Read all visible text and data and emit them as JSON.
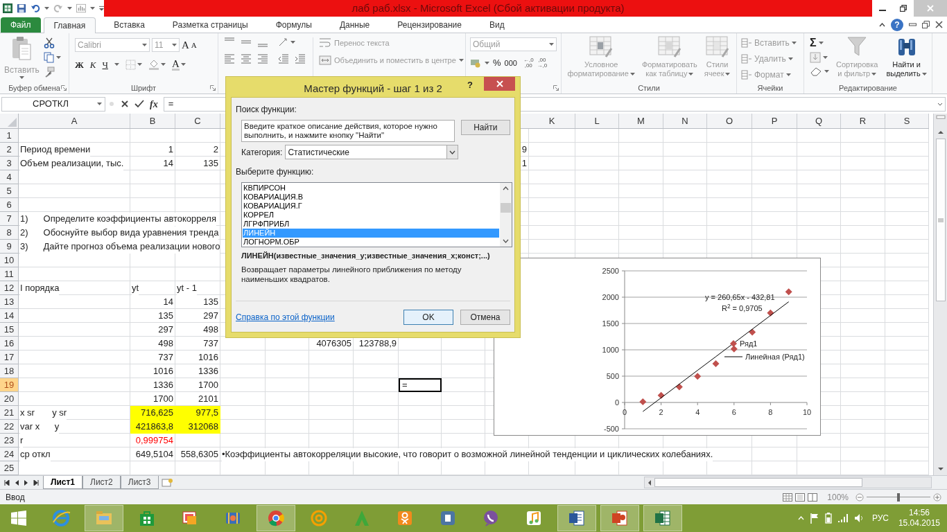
{
  "window": {
    "title": "лаб  раб.xlsx  -  Microsoft Excel (Сбой активации продукта)"
  },
  "ribbon_tabs": [
    {
      "label": "Файл",
      "kind": "file",
      "selected": false
    },
    {
      "label": "Главная",
      "kind": "tab",
      "selected": true
    },
    {
      "label": "Вставка",
      "kind": "tab",
      "selected": false
    },
    {
      "label": "Разметка страницы",
      "kind": "tab",
      "selected": false
    },
    {
      "label": "Формулы",
      "kind": "tab",
      "selected": false
    },
    {
      "label": "Данные",
      "kind": "tab",
      "selected": false
    },
    {
      "label": "Рецензирование",
      "kind": "tab",
      "selected": false
    },
    {
      "label": "Вид",
      "kind": "tab",
      "selected": false
    }
  ],
  "help_button": "?",
  "ribbon": {
    "clipboard": {
      "group": "Буфер обмена",
      "paste": {
        "label": "Вставить",
        "disabled": true
      }
    },
    "font": {
      "group": "Шрифт",
      "name": {
        "label": "Calibri",
        "disabled": true
      },
      "size": {
        "label": "11",
        "disabled": true
      },
      "grow": {
        "label": "A",
        "disabled": false
      },
      "shrink": {
        "label": "A",
        "disabled": false
      },
      "bold": {
        "label": "Ж",
        "disabled": false
      },
      "italic": {
        "label": "К",
        "disabled": false
      },
      "underline": {
        "label": "Ч",
        "disabled": false
      },
      "color": {
        "label": "A",
        "disabled": false
      }
    },
    "alignment": {
      "wrap": {
        "label": "Перенос текста",
        "disabled": true
      },
      "merge": {
        "label": "Объединить и поместить в центре",
        "disabled": true
      }
    },
    "number": {
      "format": {
        "label": "Общий",
        "disabled": true
      },
      "percent": {
        "label": "%",
        "disabled": false
      },
      "thousands": {
        "label": "000",
        "disabled": false
      },
      "increase_decimal": {
        "top": "←,0",
        "bottom": ",00"
      },
      "decrease_decimal": {
        "top": ",00",
        "bottom": "→,0"
      }
    },
    "styles": {
      "group": "Стили",
      "conditional": {
        "lines": [
          "Условное",
          "форматирование"
        ],
        "disabled": true
      },
      "table": {
        "lines": [
          "Форматировать",
          "как таблицу"
        ],
        "disabled": true
      },
      "cell_styles": {
        "lines": [
          "Стили",
          "ячеек"
        ],
        "disabled": true
      }
    },
    "cells": {
      "group": "Ячейки",
      "insert": {
        "label": "Вставить",
        "disabled": true
      },
      "delete": {
        "label": "Удалить",
        "disabled": true
      },
      "format": {
        "label": "Формат",
        "disabled": true
      }
    },
    "editing": {
      "group": "Редактирование",
      "sum": {
        "label": "Σ",
        "disabled": false
      },
      "sort": {
        "lines": [
          "Сортировка",
          "и фильтр"
        ],
        "disabled": true
      },
      "find": {
        "lines": [
          "Найти и",
          "выделить"
        ],
        "disabled": false
      }
    }
  },
  "formula_bar": {
    "name_box": "СРОТКЛ",
    "function_button": "fx",
    "formula": "="
  },
  "sheet": {
    "columns": [
      {
        "label": "A",
        "selected": false
      },
      {
        "label": "B",
        "selected": false
      },
      {
        "label": "C",
        "selected": false
      },
      {
        "label": "K",
        "selected": false
      },
      {
        "label": "L",
        "selected": false
      },
      {
        "label": "M",
        "selected": false
      },
      {
        "label": "N",
        "selected": false
      },
      {
        "label": "O",
        "selected": false
      },
      {
        "label": "P",
        "selected": false
      },
      {
        "label": "Q",
        "selected": false
      },
      {
        "label": "R",
        "selected": false
      },
      {
        "label": "S",
        "selected": false
      }
    ],
    "rows": [
      {
        "label": "1",
        "selected": false
      },
      {
        "label": "2",
        "selected": false,
        "A": "Период времени",
        "B": {
          "text": "1",
          "kind": "number"
        },
        "C": {
          "text": "2",
          "kind": "number"
        },
        "J": {
          "text": "9",
          "kind": "number"
        }
      },
      {
        "label": "3",
        "selected": false,
        "A": "Объем реализации, тыс.",
        "B": {
          "text": "14",
          "kind": "number"
        },
        "C": {
          "text": "135",
          "kind": "number"
        },
        "J": {
          "text": "1",
          "kind": "number"
        }
      },
      {
        "label": "4",
        "selected": false
      },
      {
        "label": "5",
        "selected": false
      },
      {
        "label": "6",
        "selected": false
      },
      {
        "label": "7",
        "selected": false,
        "A": {
          "kind": "list",
          "marker": "1)",
          "text": "Определите коэффициенты автокорреля"
        }
      },
      {
        "label": "8",
        "selected": false,
        "A": {
          "kind": "list",
          "marker": "2)",
          "text": "Обоснуйте выбор вида уравнения тренда"
        }
      },
      {
        "label": "9",
        "selected": false,
        "A": {
          "kind": "list",
          "marker": "3)",
          "text": "Дайте прогноз объема реализации нового"
        }
      },
      {
        "label": "10",
        "selected": false
      },
      {
        "label": "11",
        "selected": false
      },
      {
        "label": "12",
        "selected": false,
        "A": "I порядка",
        "B": "yt",
        "C": "yt - 1"
      },
      {
        "label": "13",
        "selected": false,
        "B": {
          "text": "14",
          "kind": "number"
        },
        "C": {
          "text": "135",
          "kind": "number"
        }
      },
      {
        "label": "14",
        "selected": false,
        "B": {
          "text": "135",
          "kind": "number"
        },
        "C": {
          "text": "297",
          "kind": "number"
        }
      },
      {
        "label": "15",
        "selected": false,
        "B": {
          "text": "297",
          "kind": "number"
        },
        "C": {
          "text": "498",
          "kind": "number"
        }
      },
      {
        "label": "16",
        "selected": false,
        "B": {
          "text": "498",
          "kind": "number"
        },
        "C": {
          "text": "737",
          "kind": "number"
        },
        "F": {
          "text": "4076305",
          "kind": "number"
        },
        "G": {
          "text": "123788,9",
          "kind": "number"
        }
      },
      {
        "label": "17",
        "selected": false,
        "B": {
          "text": "737",
          "kind": "number"
        },
        "C": {
          "text": "1016",
          "kind": "number"
        }
      },
      {
        "label": "18",
        "selected": false,
        "B": {
          "text": "1016",
          "kind": "number"
        },
        "C": {
          "text": "1336",
          "kind": "number"
        }
      },
      {
        "label": "19",
        "selected": true,
        "B": {
          "text": "1336",
          "kind": "number"
        },
        "C": {
          "text": "1700",
          "kind": "number"
        },
        "H": {
          "text": "=",
          "kind": "text",
          "selected": true
        }
      },
      {
        "label": "20",
        "selected": false,
        "B": {
          "text": "1700",
          "kind": "number"
        },
        "C": {
          "text": "2101",
          "kind": "number"
        }
      },
      {
        "label": "21",
        "selected": false,
        "A": "x sr       y sr",
        "B": {
          "text": "716,625",
          "kind": "number",
          "highlighted": true
        },
        "C": {
          "text": "977,5",
          "kind": "number",
          "highlighted": true
        }
      },
      {
        "label": "22",
        "selected": false,
        "A": "var x      y",
        "B": {
          "text": "421863,8",
          "kind": "number",
          "highlighted": true
        },
        "C": {
          "text": "312068",
          "kind": "number",
          "highlighted": true
        }
      },
      {
        "label": "23",
        "selected": false,
        "A": "r",
        "B": {
          "text": "0,999754",
          "kind": "number",
          "color": "#ff0000"
        }
      },
      {
        "label": "24",
        "selected": false,
        "A": "ср откл",
        "B": {
          "text": "649,5104",
          "kind": "number"
        },
        "C": {
          "text": "558,6305",
          "kind": "number"
        },
        "D": "•Коэффициенты автокорреляции высокие, что говорит о возможной линейной тенденции и циклических колебаниях."
      },
      {
        "label": "25",
        "selected": false
      }
    ],
    "chart": {
      "chart_data": {
        "type": "scatter",
        "x": [
          1,
          2,
          3,
          4,
          5,
          6,
          7,
          8,
          9
        ],
        "series": [
          {
            "name": "Ряд1",
            "color": "#c0504d",
            "values": [
              14,
              135,
              297,
              498,
              737,
              1016,
              1336,
              1700,
              2101
            ]
          },
          {
            "name": "Линейная (Ряд1)",
            "color": "#000000",
            "type": "line",
            "values": [
              -172,
              88,
              349,
              610,
              870,
              1131,
              1392,
              1652,
              1913
            ]
          }
        ],
        "grid": true,
        "xlim": [
          0,
          10
        ],
        "ylim": [
          -500,
          2500
        ],
        "xticks": [
          0,
          2,
          4,
          6,
          8,
          10
        ],
        "yticks": [
          -500,
          0,
          500,
          1000,
          1500,
          2000,
          2500
        ],
        "annotations": [
          "y = 260,65x - 432,81",
          "R$^{2}$ = 0,9705"
        ]
      }
    }
  },
  "dialog": {
    "title": "Мастер функций - шаг 1 из 2",
    "help": "?",
    "search_label": "Поиск функции:",
    "search_value": "Введите краткое описание действия, которое нужно выполнить, и нажмите кнопку \"Найти\"",
    "find_button": "Найти",
    "category_label": "Категория:",
    "category": "Статистические",
    "list_label": "Выберите функцию:",
    "functions": [
      {
        "label": "КВПИРСОН",
        "selected": false
      },
      {
        "label": "КОВАРИАЦИЯ.В",
        "selected": false
      },
      {
        "label": "КОВАРИАЦИЯ.Г",
        "selected": false
      },
      {
        "label": "КОРРЕЛ",
        "selected": false
      },
      {
        "label": "ЛГРФПРИБЛ",
        "selected": false
      },
      {
        "label": "ЛИНЕЙН",
        "selected": true
      },
      {
        "label": "ЛОГНОРМ.ОБР",
        "selected": false
      }
    ],
    "signature": "ЛИНЕЙН(известные_значения_y;известные_значения_x;конст;...)",
    "description": "Возвращает параметры линейного приближения по методу наименьших квадратов.",
    "help_link": "Справка по этой функции",
    "ok": "OK",
    "cancel": "Отмена"
  },
  "sheet_tabs": [
    {
      "label": "Лист1",
      "selected": true
    },
    {
      "label": "Лист2",
      "selected": false
    },
    {
      "label": "Лист3",
      "selected": false
    }
  ],
  "status_bar": {
    "mode": "Ввод",
    "zoom": "100%",
    "zoom_slider": {
      "level": 0.5
    }
  },
  "taskbar": {
    "apps": [
      {
        "kind": "ie",
        "running": false
      },
      {
        "kind": "explorer",
        "running": true
      },
      {
        "kind": "store",
        "running": false
      },
      {
        "kind": "photos",
        "running": false
      },
      {
        "kind": "media",
        "running": false
      },
      {
        "kind": "chrome",
        "running": true
      },
      {
        "kind": "mail",
        "running": false
      },
      {
        "kind": "font",
        "running": false
      },
      {
        "kind": "ok",
        "running": false
      },
      {
        "kind": "vk",
        "running": false
      },
      {
        "kind": "viber",
        "running": false
      },
      {
        "kind": "music",
        "running": false
      },
      {
        "kind": "word",
        "running": true
      },
      {
        "kind": "powerpoint",
        "running": true
      },
      {
        "kind": "excel",
        "running": true
      }
    ],
    "language": "РУС",
    "time": "14:56",
    "date": "15.04.2015"
  }
}
